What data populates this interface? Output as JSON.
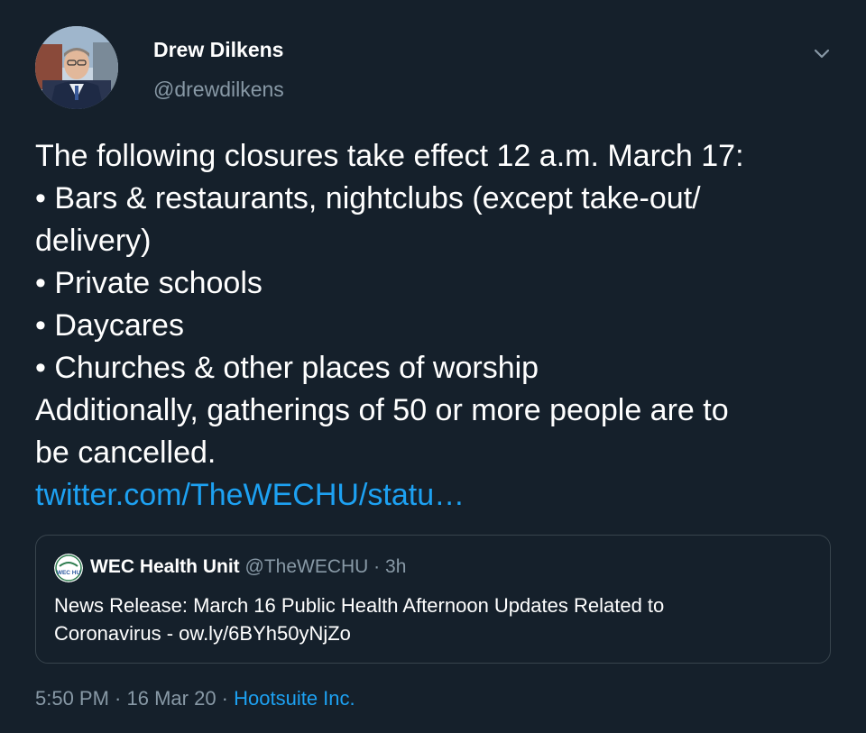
{
  "author": {
    "name": "Drew Dilkens",
    "handle": "@drewdilkens"
  },
  "body": {
    "lines": [
      "The following closures take effect 12 a.m. March 17:",
      "• Bars & restaurants, nightclubs (except take-out/",
      "delivery)",
      "• Private schools",
      "• Daycares",
      "• Churches & other places of worship",
      "Additionally, gatherings of 50 or more people are to",
      "be cancelled."
    ],
    "link": "twitter.com/TheWECHU/statu…"
  },
  "quoted_tweet": {
    "avatar_text": "WEC HU",
    "name": "WEC Health Unit",
    "handle": "@TheWECHU",
    "separator": " · ",
    "time": "3h",
    "text_lines": [
      "News Release: March 16 Public Health Afternoon Updates Related to",
      "Coronavirus - ow.ly/6BYh50yNjZo"
    ]
  },
  "footer": {
    "time": "5:50 PM",
    "separator": " · ",
    "date": "16 Mar 20",
    "separator2": " · ",
    "source": "Hootsuite Inc."
  },
  "colors": {
    "background": "#15202b",
    "text": "#ffffff",
    "secondary": "#8899a6",
    "link": "#1da1f2",
    "border": "#38444d"
  },
  "icons": {
    "menu": "chevron-down-icon"
  }
}
